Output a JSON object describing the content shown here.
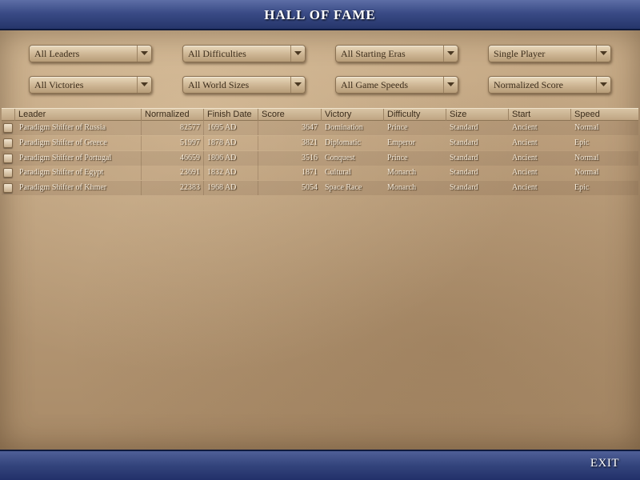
{
  "window": {
    "title": "HALL OF FAME",
    "exit_label": "EXIT"
  },
  "filters": {
    "leaders": "All Leaders",
    "difficulties": "All Difficulties",
    "starting_eras": "All Starting Eras",
    "player_mode": "Single Player",
    "victories": "All Victories",
    "world_sizes": "All World Sizes",
    "game_speeds": "All Game Speeds",
    "sort": "Normalized Score"
  },
  "table": {
    "columns": {
      "leader": "Leader",
      "normalized": "Normalized",
      "finish_date": "Finish Date",
      "score": "Score",
      "victory": "Victory",
      "difficulty": "Difficulty",
      "size": "Size",
      "start": "Start",
      "speed": "Speed"
    },
    "rows": [
      {
        "leader": "Paradigm Shifter of Russia",
        "normalized": "82577",
        "finish_date": "1695 AD",
        "score": "3647",
        "victory": "Domination",
        "difficulty": "Prince",
        "size": "Standard",
        "start": "Ancient",
        "speed": "Normal"
      },
      {
        "leader": "Paradigm Shifter of Greece",
        "normalized": "51997",
        "finish_date": "1878 AD",
        "score": "3821",
        "victory": "Diplomatic",
        "difficulty": "Emperor",
        "size": "Standard",
        "start": "Ancient",
        "speed": "Epic"
      },
      {
        "leader": "Paradigm Shifter of Portugal",
        "normalized": "46659",
        "finish_date": "1806 AD",
        "score": "3516",
        "victory": "Conquest",
        "difficulty": "Prince",
        "size": "Standard",
        "start": "Ancient",
        "speed": "Normal"
      },
      {
        "leader": "Paradigm Shifter of Egypt",
        "normalized": "23691",
        "finish_date": "1832 AD",
        "score": "1871",
        "victory": "Cultural",
        "difficulty": "Monarch",
        "size": "Standard",
        "start": "Ancient",
        "speed": "Normal"
      },
      {
        "leader": "Paradigm Shifter of Khmer",
        "normalized": "22383",
        "finish_date": "1968 AD",
        "score": "5054",
        "victory": "Space Race",
        "difficulty": "Monarch",
        "size": "Standard",
        "start": "Ancient",
        "speed": "Epic"
      }
    ]
  },
  "icons": {
    "dropdown_arrow": "chevron-down-icon",
    "row_checkbox": "checkbox-icon"
  },
  "colors": {
    "header_bar": "#3a4b86",
    "parchment": "#bb9e7b",
    "cell_text": "#f6ecdc"
  }
}
